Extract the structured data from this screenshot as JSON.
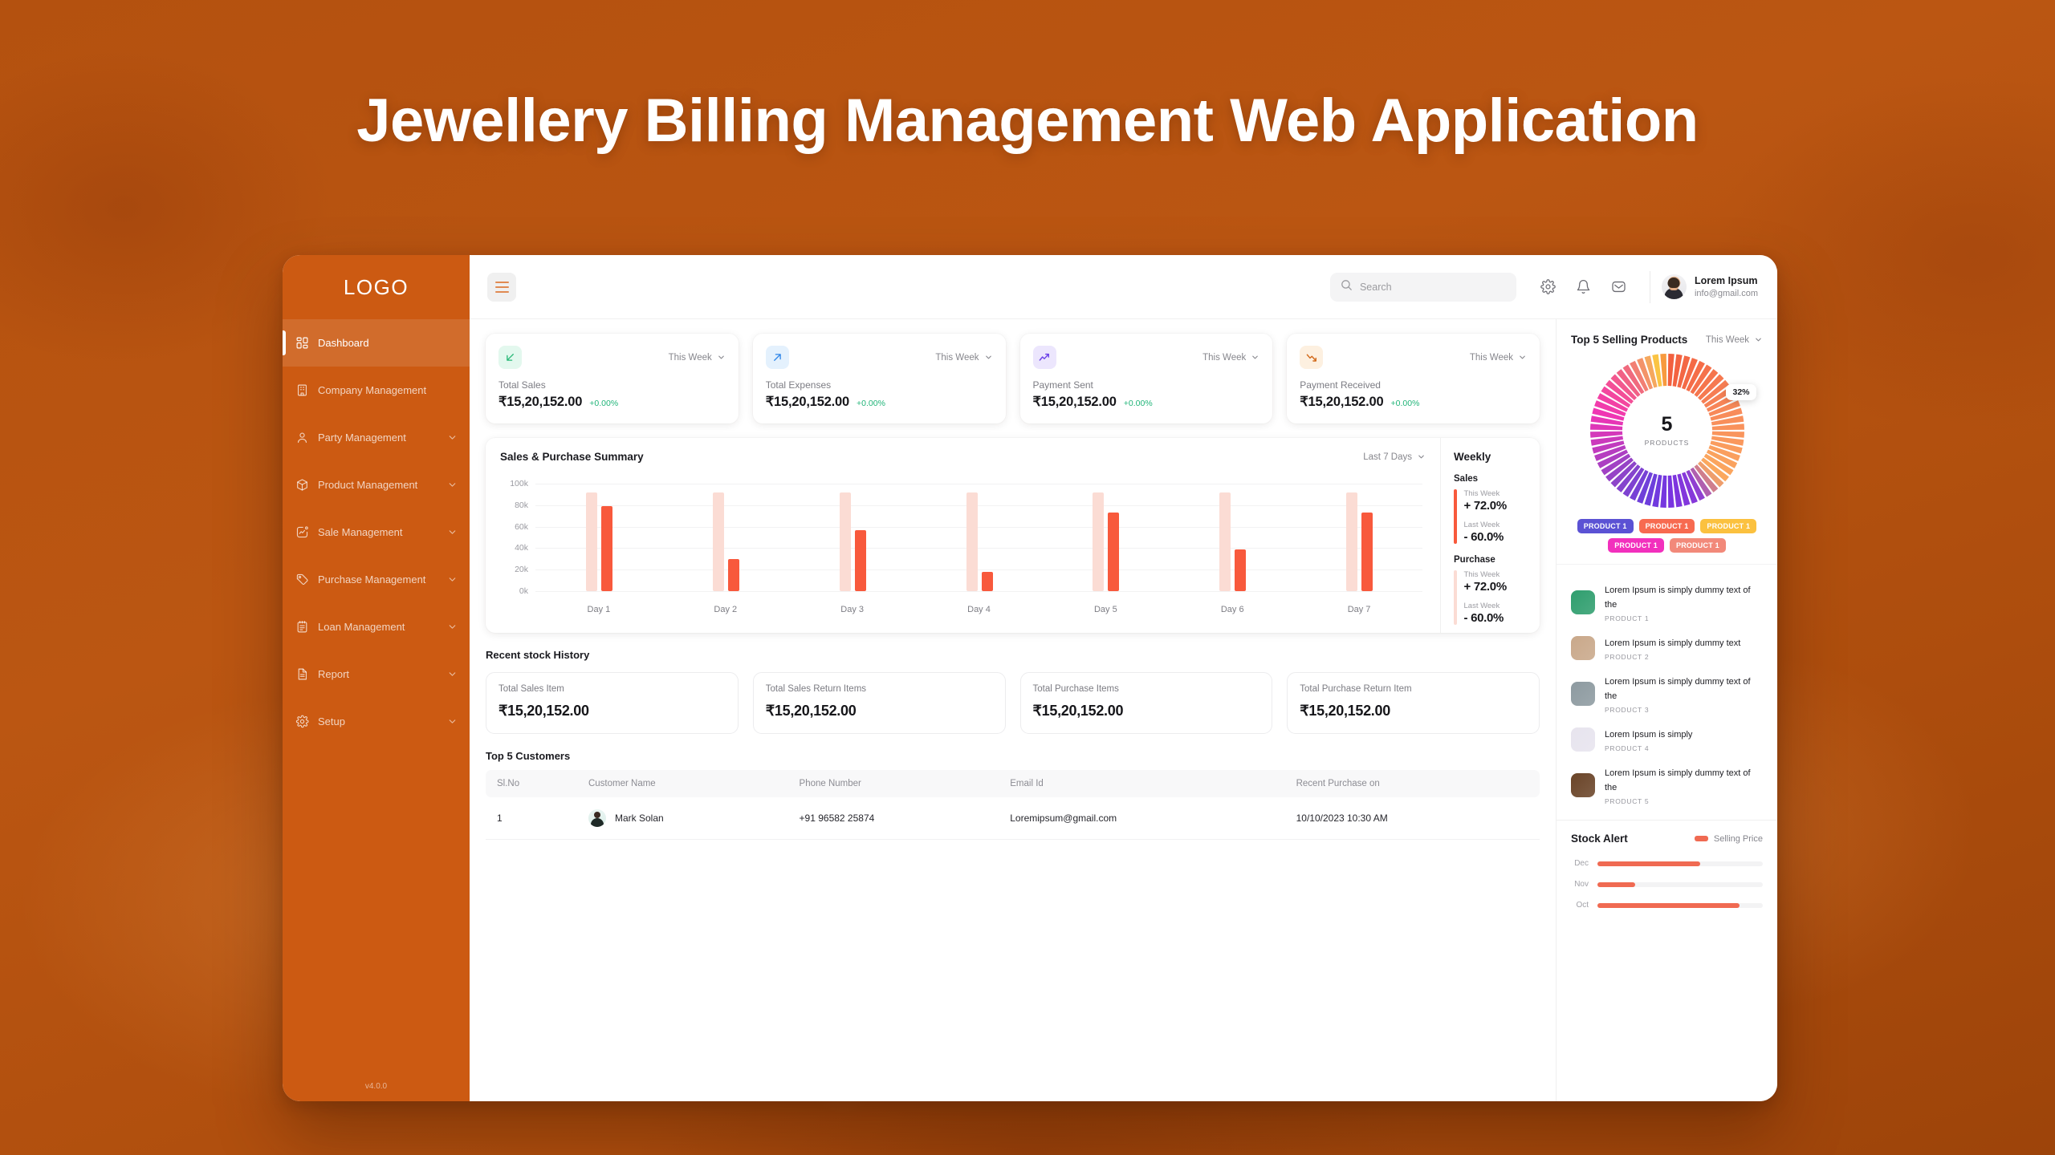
{
  "hero": {
    "title": "Jewellery Billing Management Web Application"
  },
  "sidebar": {
    "logo": "LOGO",
    "version": "v4.0.0",
    "items": [
      {
        "label": "Dashboard",
        "icon": "grid-icon",
        "active": true,
        "caret": false
      },
      {
        "label": "Company Management",
        "icon": "building-icon",
        "active": false,
        "caret": false
      },
      {
        "label": "Party Management",
        "icon": "user-icon",
        "active": false,
        "caret": true
      },
      {
        "label": "Product Management",
        "icon": "box-icon",
        "active": false,
        "caret": true
      },
      {
        "label": "Sale Management",
        "icon": "chart-square-icon",
        "active": false,
        "caret": true
      },
      {
        "label": "Purchase Management",
        "icon": "tag-icon",
        "active": false,
        "caret": true
      },
      {
        "label": "Loan Management",
        "icon": "clipboard-icon",
        "active": false,
        "caret": true
      },
      {
        "label": "Report",
        "icon": "document-icon",
        "active": false,
        "caret": true
      },
      {
        "label": "Setup",
        "icon": "gear-icon",
        "active": false,
        "caret": true
      }
    ]
  },
  "topbar": {
    "search_placeholder": "Search",
    "user_name": "Lorem Ipsum",
    "user_email": "info@gmail.com",
    "icons": [
      "gear-icon",
      "bell-icon",
      "mail-icon"
    ]
  },
  "kpis": [
    {
      "label": "Total Sales",
      "value": "₹15,20,152.00",
      "delta": "+0.00%",
      "period": "This Week",
      "icon": "arrow-down-left-icon",
      "icon_color": "#27b876",
      "icon_bg": "#e3f8ee"
    },
    {
      "label": "Total Expenses",
      "value": "₹15,20,152.00",
      "delta": "+0.00%",
      "period": "This Week",
      "icon": "arrow-up-right-icon",
      "icon_color": "#2f86e8",
      "icon_bg": "#e4f1fd"
    },
    {
      "label": "Payment Sent",
      "value": "₹15,20,152.00",
      "delta": "+0.00%",
      "period": "This Week",
      "icon": "trend-up-icon",
      "icon_color": "#6b40e8",
      "icon_bg": "#ece6fd"
    },
    {
      "label": "Payment Received",
      "value": "₹15,20,152.00",
      "delta": "+0.00%",
      "period": "This Week",
      "icon": "trend-down-icon",
      "icon_color": "#d2691a",
      "icon_bg": "#fdf0e0"
    }
  ],
  "summary": {
    "title": "Sales & Purchase Summary",
    "period": "Last 7 Days"
  },
  "chart_data": {
    "type": "bar",
    "title": "Sales & Purchase Summary",
    "categories": [
      "Day 1",
      "Day 2",
      "Day 3",
      "Day 4",
      "Day 5",
      "Day 6",
      "Day 7"
    ],
    "series": [
      {
        "name": "Purchase",
        "color": "#fbdcd4",
        "values": [
          92,
          92,
          92,
          92,
          92,
          92,
          92
        ]
      },
      {
        "name": "Sales",
        "color": "#f8593c",
        "values": [
          79,
          30,
          57,
          18,
          73,
          39,
          73
        ]
      }
    ],
    "ylabel": "",
    "xlabel": "",
    "ylim": [
      0,
      100
    ],
    "yticks": [
      0,
      20,
      40,
      60,
      80,
      100
    ],
    "ytick_labels": [
      "0k",
      "20k",
      "40k",
      "60k",
      "80k",
      "100k"
    ],
    "grid": true,
    "legend": false
  },
  "weekly": {
    "title": "Weekly",
    "groups": [
      {
        "name": "Sales",
        "bar_color": "#f8593c",
        "rows": [
          {
            "label": "This Week",
            "value": "+ 72.0%"
          },
          {
            "label": "Last Week",
            "value": "- 60.0%"
          }
        ]
      },
      {
        "name": "Purchase",
        "bar_color": "#fbdcd4",
        "rows": [
          {
            "label": "This Week",
            "value": "+ 72.0%"
          },
          {
            "label": "Last Week",
            "value": "- 60.0%"
          }
        ]
      }
    ]
  },
  "stock_history": {
    "title": "Recent stock History",
    "cards": [
      {
        "label": "Total Sales Item",
        "value": "₹15,20,152.00"
      },
      {
        "label": "Total Sales Return Items",
        "value": "₹15,20,152.00"
      },
      {
        "label": "Total Purchase Items",
        "value": "₹15,20,152.00"
      },
      {
        "label": "Total Purchase Return Item",
        "value": "₹15,20,152.00"
      }
    ]
  },
  "customers": {
    "title": "Top 5 Customers",
    "columns": [
      "Sl.No",
      "Customer Name",
      "Phone Number",
      "Email Id",
      "Recent Purchase on"
    ],
    "rows": [
      {
        "slno": "1",
        "name": "Mark Solan",
        "phone": "+91 96582 25874",
        "email": "Loremipsum@gmail.com",
        "recent": "10/10/2023 10:30 AM"
      }
    ]
  },
  "top_selling": {
    "title": "Top 5 Selling Products",
    "period": "This Week",
    "donut_number": "5",
    "donut_sub": "PRODUCTS",
    "badge": "32%",
    "tags": [
      {
        "label": "PRODUCT 1",
        "color": "#5b52d4"
      },
      {
        "label": "PRODUCT 1",
        "color": "#f76a50"
      },
      {
        "label": "PRODUCT 1",
        "color": "#fbc13f"
      },
      {
        "label": "PRODUCT 1",
        "color": "#f230bd"
      },
      {
        "label": "PRODUCT 1",
        "color": "#f2897a"
      }
    ],
    "products": [
      {
        "name": "Lorem Ipsum is simply dummy text of the",
        "sub": "PRODUCT 1",
        "thumb": "#2f9e6e"
      },
      {
        "name": "Lorem Ipsum is simply dummy text",
        "sub": "PRODUCT 2",
        "thumb": "#c9a88a"
      },
      {
        "name": "Lorem Ipsum is simply dummy text of the",
        "sub": "PRODUCT 3",
        "thumb": "#8d9aa0"
      },
      {
        "name": "Lorem Ipsum is simply",
        "sub": "PRODUCT 4",
        "thumb": "#e7e4ee"
      },
      {
        "name": "Lorem Ipsum is simply dummy text of the",
        "sub": "PRODUCT 5",
        "thumb": "#6a4428"
      }
    ]
  },
  "stock_alert": {
    "title": "Stock Alert",
    "legend_label": "Selling Price",
    "legend_color": "#f06a52",
    "rows": [
      {
        "month": "Dec",
        "percent": 62
      },
      {
        "month": "Nov",
        "percent": 23
      },
      {
        "month": "Oct",
        "percent": 86
      }
    ]
  }
}
